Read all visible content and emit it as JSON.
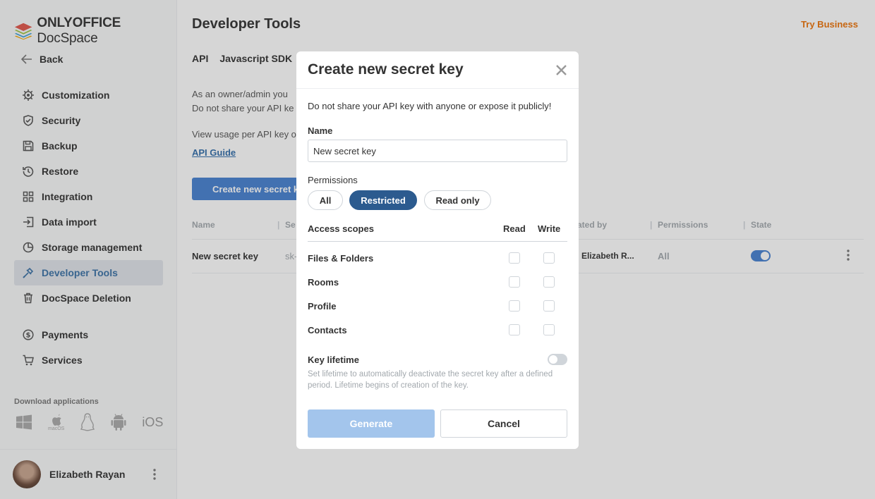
{
  "brand": {
    "name_bold": "ONLYOFFICE",
    "name_regular": " DocSpace"
  },
  "sidebar": {
    "back_label": "Back",
    "items": [
      {
        "label": "Customization",
        "icon": "gear-icon"
      },
      {
        "label": "Security",
        "icon": "shield-icon"
      },
      {
        "label": "Backup",
        "icon": "save-icon"
      },
      {
        "label": "Restore",
        "icon": "history-icon"
      },
      {
        "label": "Integration",
        "icon": "grid-icon"
      },
      {
        "label": "Data import",
        "icon": "import-icon"
      },
      {
        "label": "Storage management",
        "icon": "pie-icon"
      },
      {
        "label": "Developer Tools",
        "icon": "tools-icon",
        "active": true
      },
      {
        "label": "DocSpace Deletion",
        "icon": "trash-icon"
      }
    ],
    "items2": [
      {
        "label": "Payments",
        "icon": "dollar-icon"
      },
      {
        "label": "Services",
        "icon": "cart-icon"
      }
    ],
    "download_label": "Download applications",
    "ios_label": "iOS",
    "macos_label": "macOS",
    "user_name": "Elizabeth Rayan"
  },
  "main": {
    "title": "Developer Tools",
    "try_business": "Try Business",
    "tabs": [
      "API",
      "Javascript SDK"
    ],
    "desc_line1": "As an owner/admin you",
    "desc_line2": "Do not share your API ke",
    "desc_line3": "View usage per API key o",
    "api_guide": "API Guide",
    "create_button": "Create new secret k",
    "table": {
      "headers": {
        "name": "Name",
        "secret": "Se",
        "created_by": "ated by",
        "permissions": "Permissions",
        "state": "State"
      },
      "row": {
        "name": "New secret key",
        "secret": "sk-",
        "created_by": "Elizabeth R...",
        "permissions": "All"
      }
    }
  },
  "modal": {
    "title": "Create new secret key",
    "warning": "Do not share your API key with anyone or expose it publicly!",
    "name_label": "Name",
    "name_value": "New secret key",
    "permissions_label": "Permissions",
    "permissions": [
      "All",
      "Restricted",
      "Read only"
    ],
    "selected_permission": "Restricted",
    "scopes_label": "Access scopes",
    "read_label": "Read",
    "write_label": "Write",
    "scopes": [
      "Files & Folders",
      "Rooms",
      "Profile",
      "Contacts"
    ],
    "lifetime_label": "Key lifetime",
    "lifetime_desc": "Set lifetime to automatically deactivate the secret key after a defined period. Lifetime begins of creation of the key.",
    "generate_label": "Generate",
    "cancel_label": "Cancel"
  },
  "colors": {
    "accent": "#4781d1",
    "selected_pill": "#2c5b8f",
    "try_business": "#ed7309",
    "generate_disabled": "#a3c5ec"
  }
}
